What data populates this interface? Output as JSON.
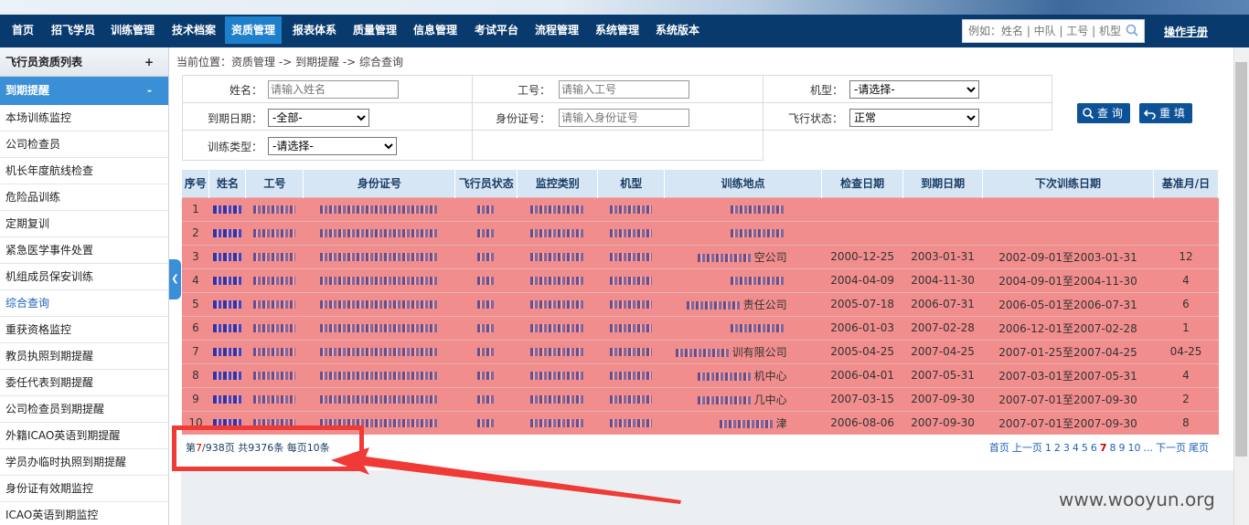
{
  "nav": {
    "items": [
      "首页",
      "招飞学员",
      "训练管理",
      "技术档案",
      "资质管理",
      "报表体系",
      "质量管理",
      "信息管理",
      "考试平台",
      "流程管理",
      "系统管理",
      "系统版本"
    ],
    "active": "资质管理",
    "search_placeholder": "例如：姓名 | 中队 | 工号 | 机型",
    "manual": "操作手册"
  },
  "sidebar": {
    "header": "飞行员资质列表",
    "header_toggle": "+",
    "section": "到期提醒",
    "section_toggle": "-",
    "items": [
      "本场训练监控",
      "公司检查员",
      "机长年度航线检查",
      "危险品训练",
      "定期复训",
      "紧急医学事件处置",
      "机组成员保安训练",
      "综合查询",
      "重获资格监控",
      "教员执照到期提醒",
      "委任代表到期提醒",
      "公司检查员到期提醒",
      "外籍ICAO英语到期提醒",
      "学员办临时执照到期提醒",
      "身份证有效期监控",
      "ICAO英语到期监控"
    ],
    "active_item": "综合查询"
  },
  "breadcrumb": "当前位置：资质管理 -> 到期提醒 -> 综合查询",
  "filter": {
    "name_label": "姓名：",
    "name_placeholder": "请输入姓名",
    "id_label": "工号：",
    "id_placeholder": "请输入工号",
    "type_label": "机型：",
    "type_value": "-请选择-",
    "due_label": "到期日期：",
    "due_value": "-全部-",
    "idcard_label": "身份证号：",
    "idcard_placeholder": "请输入身份证号",
    "status_label": "飞行状态：",
    "status_value": "正常",
    "train_label": "训练类型：",
    "train_value": "-请选择-",
    "query_btn": "查 询",
    "reset_btn": "重 填"
  },
  "table": {
    "headers": [
      "序号",
      "姓名",
      "工号",
      "身份证号",
      "飞行员状态",
      "监控类别",
      "机型",
      "训练地点",
      "检查日期",
      "到期日期",
      "下次训练日期",
      "基准月/日"
    ],
    "rows": [
      {
        "seq": "1",
        "place": "",
        "check": "",
        "due": "",
        "next": "",
        "base": ""
      },
      {
        "seq": "2",
        "place": "",
        "check": "",
        "due": "",
        "next": "",
        "base": ""
      },
      {
        "seq": "3",
        "place": "空公司",
        "check": "2000-12-25",
        "due": "2003-01-31",
        "next": "2002-09-01至2003-01-31",
        "base": "12"
      },
      {
        "seq": "4",
        "place": "",
        "check": "2004-04-09",
        "due": "2004-11-30",
        "next": "2004-09-01至2004-11-30",
        "base": "4"
      },
      {
        "seq": "5",
        "place": "责任公司",
        "check": "2005-07-18",
        "due": "2006-07-31",
        "next": "2006-05-01至2006-07-31",
        "base": "6"
      },
      {
        "seq": "6",
        "place": "",
        "check": "2006-01-03",
        "due": "2007-02-28",
        "next": "2006-12-01至2007-02-28",
        "base": "1"
      },
      {
        "seq": "7",
        "place": "训有限公司",
        "check": "2005-04-25",
        "due": "2007-04-25",
        "next": "2007-01-25至2007-04-25",
        "base": "04-25"
      },
      {
        "seq": "8",
        "place": "机中心",
        "check": "2006-04-01",
        "due": "2007-05-31",
        "next": "2007-03-01至2007-05-31",
        "base": "4"
      },
      {
        "seq": "9",
        "place": "几中心",
        "check": "2007-03-15",
        "due": "2007-09-30",
        "next": "2007-07-01至2007-09-30",
        "base": "2"
      },
      {
        "seq": "10",
        "place": "津",
        "check": "2006-08-06",
        "due": "2007-09-30",
        "next": "2007-07-01至2007-09-30",
        "base": "8"
      }
    ]
  },
  "pager": {
    "info_prefix": "第",
    "current": "7",
    "info_suffix": "/938页 共9376条 每页10条",
    "links": [
      "首页",
      "上一页",
      "1",
      "2",
      "3",
      "4",
      "5",
      "6",
      "7",
      "8",
      "9",
      "10",
      "...",
      "下一页",
      "尾页"
    ]
  },
  "watermark": "www.wooyun.org",
  "colors": {
    "nav_bg": "#083a6e",
    "active_nav": "#1e7fcb",
    "row_highlight": "#f28d8d",
    "highlight_box": "#f03a35"
  }
}
